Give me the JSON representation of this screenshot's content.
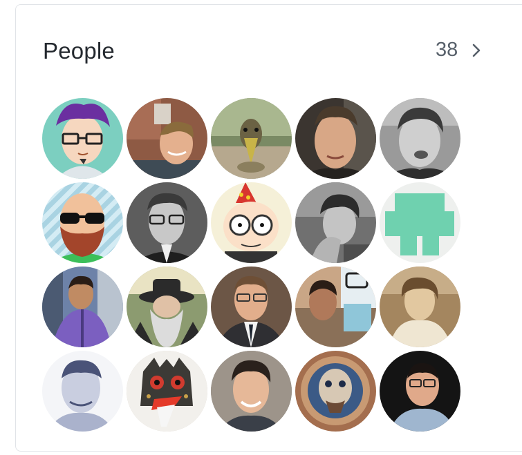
{
  "section": {
    "title": "People",
    "count": "38"
  },
  "people": [
    {
      "name": "cartoon-purple-hair",
      "bg": "#7ccfc0"
    },
    {
      "name": "smiling-man-brick",
      "bg": "#8e5a44"
    },
    {
      "name": "duck",
      "bg": "#7a8a64"
    },
    {
      "name": "man-dark-bg",
      "bg": "#3b3530"
    },
    {
      "name": "man-grayscale",
      "bg": "#9a9a9a"
    },
    {
      "name": "cartoon-bald-beard",
      "bg": "#bfe0ec"
    },
    {
      "name": "man-glasses-bw",
      "bg": "#505050"
    },
    {
      "name": "cartoon-party-hat",
      "bg": "#f5f0d8"
    },
    {
      "name": "man-thinking-bw",
      "bg": "#707070"
    },
    {
      "name": "identicon",
      "bg": "#eef0ee"
    },
    {
      "name": "man-purple-shirt",
      "bg": "#6d82a8"
    },
    {
      "name": "man-hat-beard",
      "bg": "#8c9b70"
    },
    {
      "name": "man-glasses-suit",
      "bg": "#6c5646"
    },
    {
      "name": "man-glasses-collage",
      "bg": "#c9a686"
    },
    {
      "name": "woman-sepia",
      "bg": "#a4865f"
    },
    {
      "name": "man-blue-tint",
      "bg": "#d7dbe8"
    },
    {
      "name": "robot-mask",
      "bg": "#cfc6b8"
    },
    {
      "name": "man-smiling-wall",
      "bg": "#8b8278"
    },
    {
      "name": "lion-art",
      "bg": "#a46e4e"
    },
    {
      "name": "man-black-bg",
      "bg": "#141414"
    }
  ]
}
